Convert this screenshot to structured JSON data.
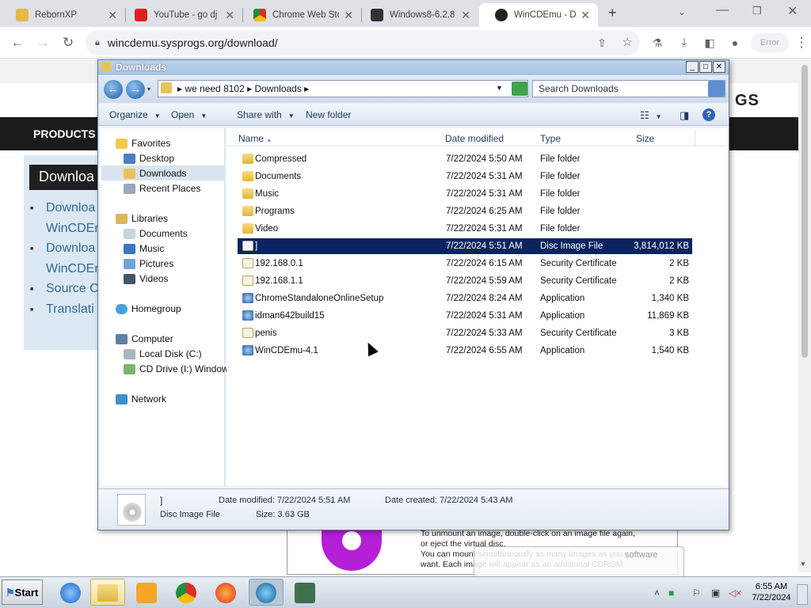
{
  "browser": {
    "tabs": [
      {
        "label": "RebornXP",
        "icon": "rebornxp-icon"
      },
      {
        "label": "YouTube - go dj",
        "icon": "youtube-icon"
      },
      {
        "label": "Chrome Web Sto",
        "icon": "chrome-webstore-icon"
      },
      {
        "label": "Windows8-6.2.8",
        "icon": "archive-icon"
      },
      {
        "label": "WinCDEmu - Do",
        "icon": "gear-icon"
      }
    ],
    "new_tab": "+",
    "url": "wincdemu.sysprogs.org/download/",
    "profile_button": "Error"
  },
  "webpage": {
    "nav_item": "PRODUCTS",
    "logo_text": "GS",
    "downloads_header": "Downloa",
    "links": [
      "Downloa",
      "WinCDEr",
      "Downloa",
      "WinCDEr",
      "Source C",
      "Translati"
    ],
    "popup_text": [
      "To unmount an image, double-click on an image file again,",
      "or eject the virtual disc.",
      "You can mount simultaneously as many images as you",
      "want. Each image will appear as an additional CDROM"
    ],
    "balloon_text": "software"
  },
  "explorer": {
    "title": "Downloads",
    "breadcrumb": [
      "we need 8102",
      "Downloads"
    ],
    "search_placeholder": "Search Downloads",
    "commands": [
      "Organize",
      "Open",
      "Share with",
      "New folder"
    ],
    "nav": {
      "favorites": "Favorites",
      "favorites_items": [
        "Desktop",
        "Downloads",
        "Recent Places"
      ],
      "libraries": "Libraries",
      "libraries_items": [
        "Documents",
        "Music",
        "Pictures",
        "Videos"
      ],
      "homegroup": "Homegroup",
      "computer": "Computer",
      "computer_items": [
        "Local Disk (C:)",
        "CD Drive (I:) Windows"
      ],
      "network": "Network"
    },
    "columns": [
      "Name",
      "Date modified",
      "Type",
      "Size"
    ],
    "files": [
      {
        "name": "Compressed",
        "date": "7/22/2024 5:50 AM",
        "type": "File folder",
        "size": "",
        "icon": "folder-icon"
      },
      {
        "name": "Documents",
        "date": "7/22/2024 5:31 AM",
        "type": "File folder",
        "size": "",
        "icon": "folder-icon"
      },
      {
        "name": "Music",
        "date": "7/22/2024 5:31 AM",
        "type": "File folder",
        "size": "",
        "icon": "folder-icon"
      },
      {
        "name": "Programs",
        "date": "7/22/2024 6:25 AM",
        "type": "File folder",
        "size": "",
        "icon": "folder-icon"
      },
      {
        "name": "Video",
        "date": "7/22/2024 5:31 AM",
        "type": "File folder",
        "size": "",
        "icon": "folder-icon"
      },
      {
        "name": "]",
        "date": "7/22/2024 5:51 AM",
        "type": "Disc Image File",
        "size": "3,814,012 KB",
        "icon": "disc-image-icon",
        "selected": true
      },
      {
        "name": "192.168.0.1",
        "date": "7/22/2024 6:15 AM",
        "type": "Security Certificate",
        "size": "2 KB",
        "icon": "certificate-icon"
      },
      {
        "name": "192.168.1.1",
        "date": "7/22/2024 5:59 AM",
        "type": "Security Certificate",
        "size": "2 KB",
        "icon": "certificate-icon"
      },
      {
        "name": "ChromeStandaloneOnlineSetup",
        "date": "7/22/2024 8:24 AM",
        "type": "Application",
        "size": "1,340 KB",
        "icon": "application-icon"
      },
      {
        "name": "idman642build15",
        "date": "7/22/2024 5:31 AM",
        "type": "Application",
        "size": "11,869 KB",
        "icon": "application-icon"
      },
      {
        "name": "penis",
        "date": "7/22/2024 5:33 AM",
        "type": "Security Certificate",
        "size": "3 KB",
        "icon": "certificate-icon"
      },
      {
        "name": "WinCDEmu-4.1",
        "date": "7/22/2024 6:55 AM",
        "type": "Application",
        "size": "1,540 KB",
        "icon": "application-icon"
      }
    ],
    "details": {
      "name": "]",
      "type": "Disc Image File",
      "date_modified_label": "Date modified:",
      "date_modified": "7/22/2024 5:51 AM",
      "date_created_label": "Date created:",
      "date_created": "7/22/2024 5:43 AM",
      "size_label": "Size:",
      "size": "3.63 GB"
    }
  },
  "taskbar": {
    "start": "Start",
    "time": "6:55 AM",
    "date": "7/22/2024"
  },
  "colors": {
    "selection": "#0b2460",
    "tabstrip": "#dee1e6",
    "nav": "#1b1b1b",
    "link": "#2f6b9a"
  }
}
